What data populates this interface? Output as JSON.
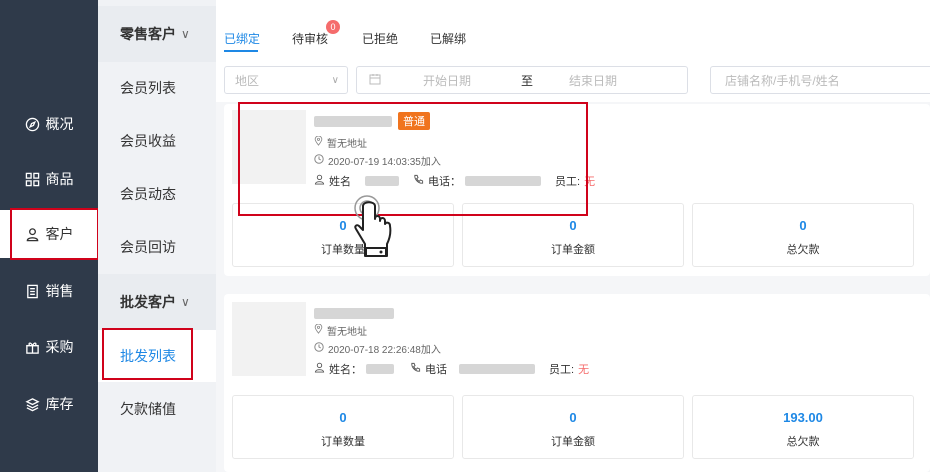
{
  "nav": {
    "items": [
      {
        "label": "概况",
        "icon": "compass-icon"
      },
      {
        "label": "商品",
        "icon": "grid-icon"
      },
      {
        "label": "客户",
        "icon": "user-icon"
      },
      {
        "label": "销售",
        "icon": "document-icon"
      },
      {
        "label": "采购",
        "icon": "gift-icon"
      },
      {
        "label": "库存",
        "icon": "layers-icon"
      }
    ]
  },
  "subnav": {
    "retail_header": "零售客户",
    "retail_items": [
      "会员列表",
      "会员收益",
      "会员动态",
      "会员回访"
    ],
    "wholesale_header": "批发客户",
    "wholesale_items": [
      "批发列表",
      "欠款储值"
    ]
  },
  "tabs": [
    {
      "label": "已绑定"
    },
    {
      "label": "待审核",
      "badge": "0"
    },
    {
      "label": "已拒绝"
    },
    {
      "label": "已解绑"
    }
  ],
  "filters": {
    "region_placeholder": "地区",
    "start_date_placeholder": "开始日期",
    "to_label": "至",
    "end_date_placeholder": "结束日期",
    "search_placeholder": "店铺名称/手机号/姓名"
  },
  "customers": [
    {
      "tag": "普通",
      "address": "暂无地址",
      "joined": "2020-07-19 14:03:35加入",
      "name_label": "姓名",
      "phone_label": "电话：",
      "staff_label": "员工:",
      "staff_value": "无",
      "stats": [
        {
          "value": "0",
          "label": "订单数量"
        },
        {
          "value": "0",
          "label": "订单金额"
        },
        {
          "value": "0",
          "label": "总欠款"
        }
      ]
    },
    {
      "tag": "",
      "address": "暂无地址",
      "joined": "2020-07-18 22:26:48加入",
      "name_label": "姓名：",
      "phone_label": "电话",
      "staff_label": "员工:",
      "staff_value": "无",
      "stats": [
        {
          "value": "0",
          "label": "订单数量"
        },
        {
          "value": "0",
          "label": "订单金额"
        },
        {
          "value": "193.00",
          "label": "总欠款"
        }
      ]
    }
  ],
  "colors": {
    "accent": "#1e88e5",
    "nav_bg": "#2f3a4a",
    "highlight": "#d0021b",
    "tag": "#f0741e"
  }
}
